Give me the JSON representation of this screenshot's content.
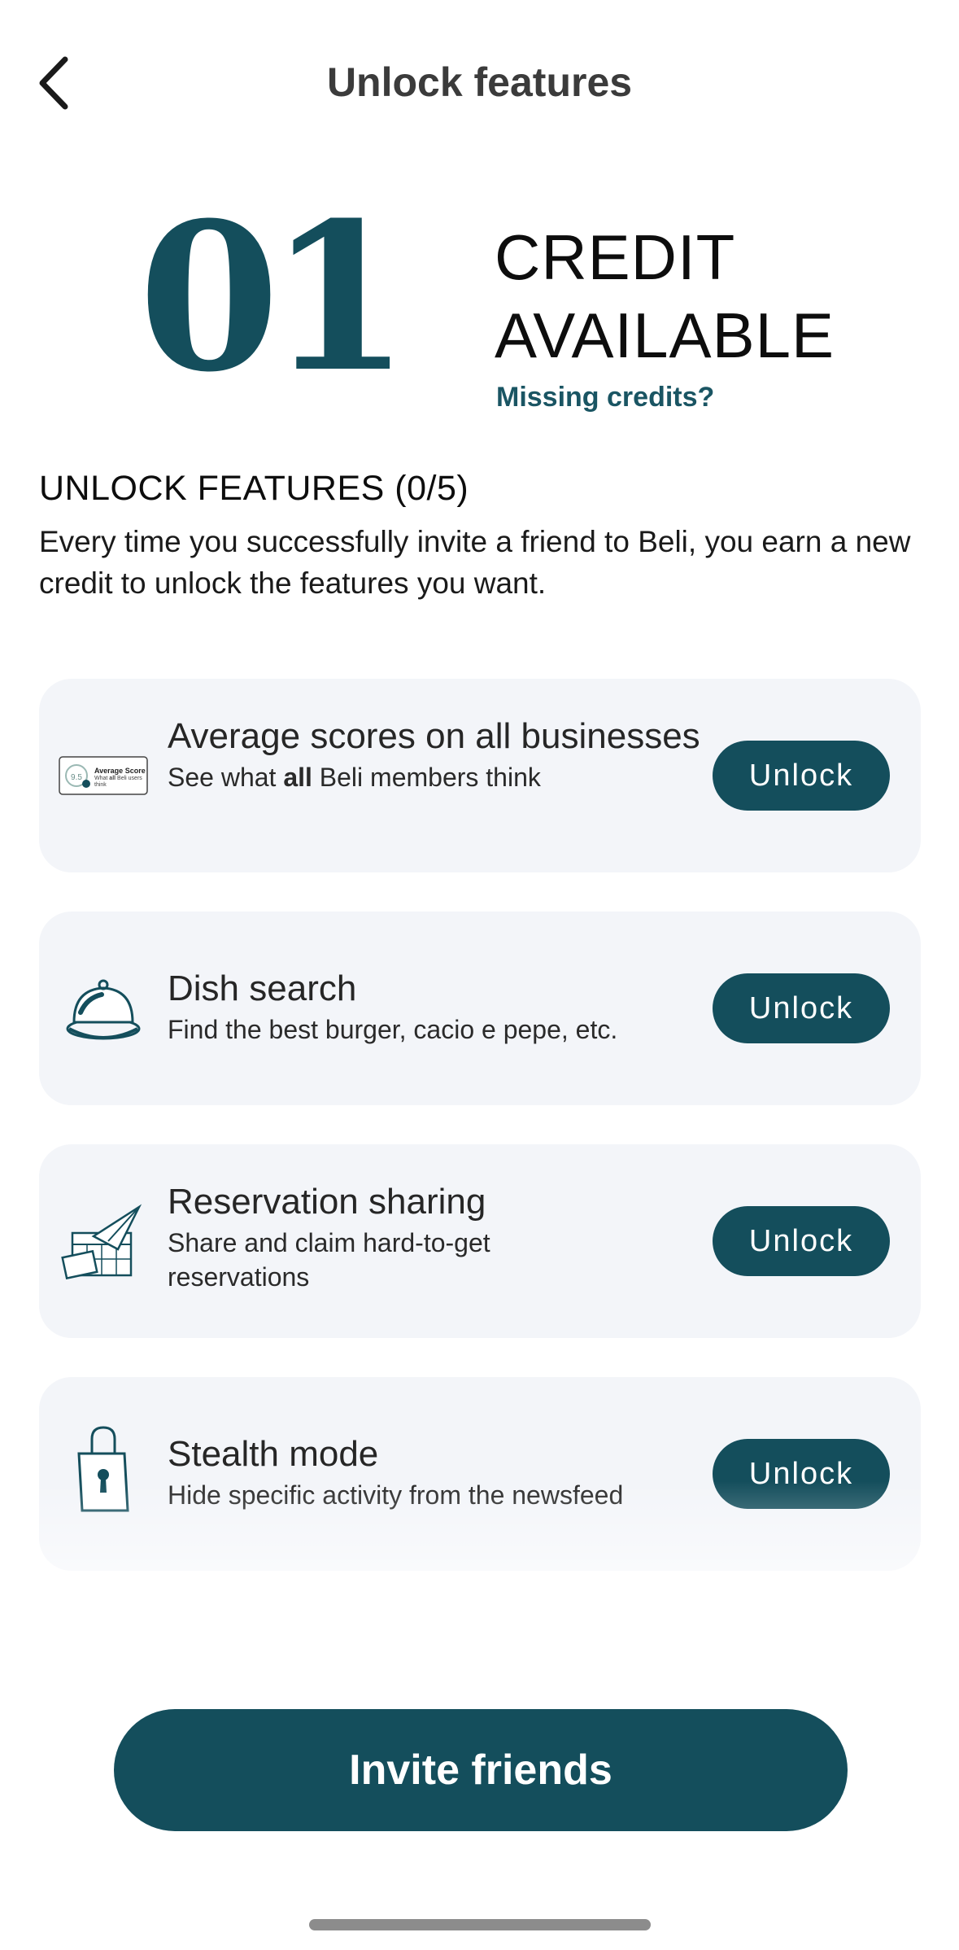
{
  "header": {
    "title": "Unlock features",
    "back_icon": "chevron-left-icon"
  },
  "credits": {
    "count": "01",
    "label_line1": "CREDIT",
    "label_line2": "AVAILABLE",
    "missing_link": "Missing credits?"
  },
  "section": {
    "title": "UNLOCK FEATURES (0/5)",
    "description": "Every time you successfully invite a friend to Beli, you earn a new credit to unlock the features you want."
  },
  "features": [
    {
      "icon": "average-score-card-icon",
      "title": "Average scores on all businesses",
      "subtitle_pre": "See what ",
      "subtitle_bold": "all",
      "subtitle_post": " Beli members think",
      "icon_score": "9.5",
      "icon_label": "Average Score",
      "icon_caption_pre": "What ",
      "icon_caption_bold": "all",
      "icon_caption_post": " Beli users think",
      "button": "Unlock"
    },
    {
      "icon": "cloche-icon",
      "title": "Dish search",
      "subtitle": "Find the best burger, cacio e pepe, etc.",
      "button": "Unlock"
    },
    {
      "icon": "reservation-share-icon",
      "title": "Reservation sharing",
      "subtitle": "Share and claim hard-to-get reservations",
      "button": "Unlock"
    },
    {
      "icon": "padlock-icon",
      "title": "Stealth mode",
      "subtitle": "Hide specific activity from the newsfeed",
      "button": "Unlock"
    }
  ],
  "cta": {
    "label": "Invite friends"
  },
  "colors": {
    "primary": "#144e5c",
    "card_bg": "#f3f5f9",
    "text": "#262626"
  }
}
